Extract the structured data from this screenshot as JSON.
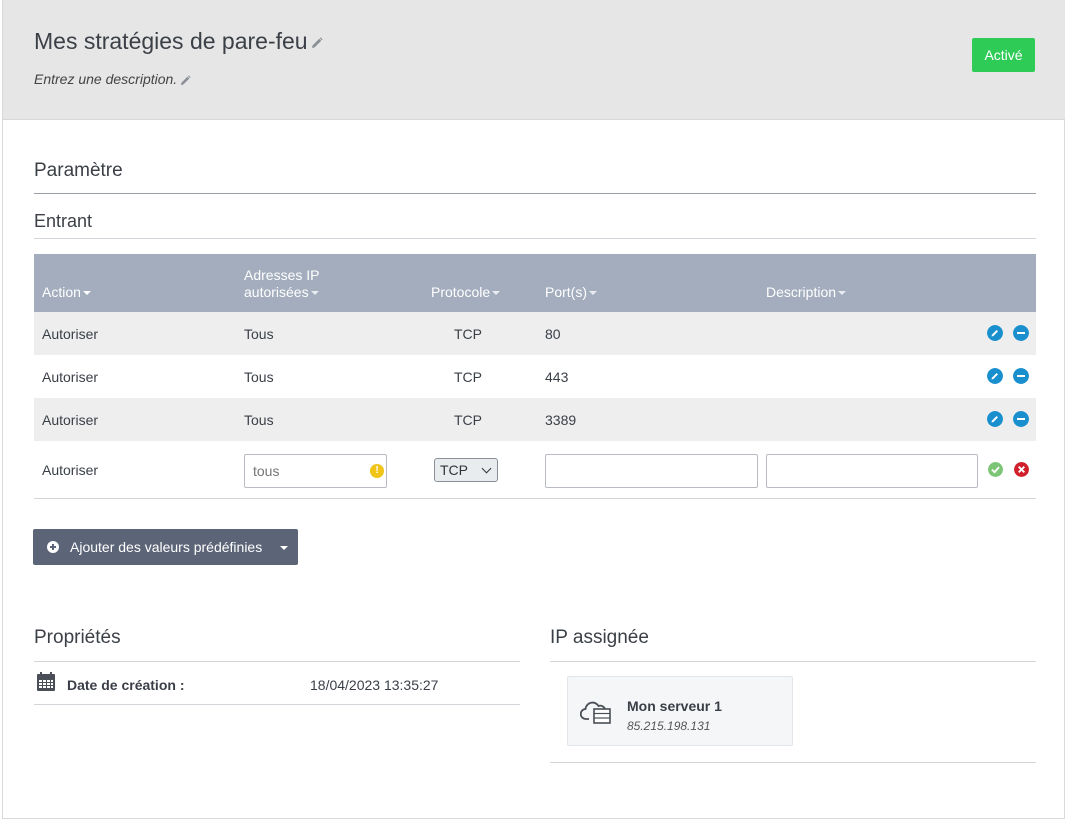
{
  "header": {
    "title": "Mes stratégies de pare-feu",
    "description": "Entrez une description.",
    "status_label": "Activé"
  },
  "sections": {
    "settings": "Paramètre",
    "inbound": "Entrant",
    "properties": "Propriétés",
    "assigned_ip": "IP assignée"
  },
  "table": {
    "columns": {
      "action": "Action",
      "ip_line1": "Adresses IP",
      "ip_line2": "autorisées",
      "protocol": "Protocole",
      "ports": "Port(s)",
      "description": "Description"
    },
    "rows": [
      {
        "action": "Autoriser",
        "ip": "Tous",
        "protocol": "TCP",
        "ports": "80",
        "description": ""
      },
      {
        "action": "Autoriser",
        "ip": "Tous",
        "protocol": "TCP",
        "ports": "443",
        "description": ""
      },
      {
        "action": "Autoriser",
        "ip": "Tous",
        "protocol": "TCP",
        "ports": "3389",
        "description": ""
      }
    ],
    "new_row": {
      "action": "Autoriser",
      "ip_placeholder": "tous",
      "protocol_selected": "TCP",
      "ports_value": "",
      "description_value": ""
    }
  },
  "preset_button": "Ajouter des valeurs prédéfinies",
  "properties": {
    "creation_label": "Date de création :",
    "creation_value": "18/04/2023 13:35:27"
  },
  "server": {
    "name": "Mon serveur 1",
    "ip": "85.215.198.131"
  },
  "colors": {
    "accent_blue": "#1a8fce",
    "status_green": "#2ecc57",
    "header_bar": "#a3adbd",
    "warn": "#f0c419",
    "cancel_red": "#d0202c",
    "confirm_green": "#7cc576"
  }
}
